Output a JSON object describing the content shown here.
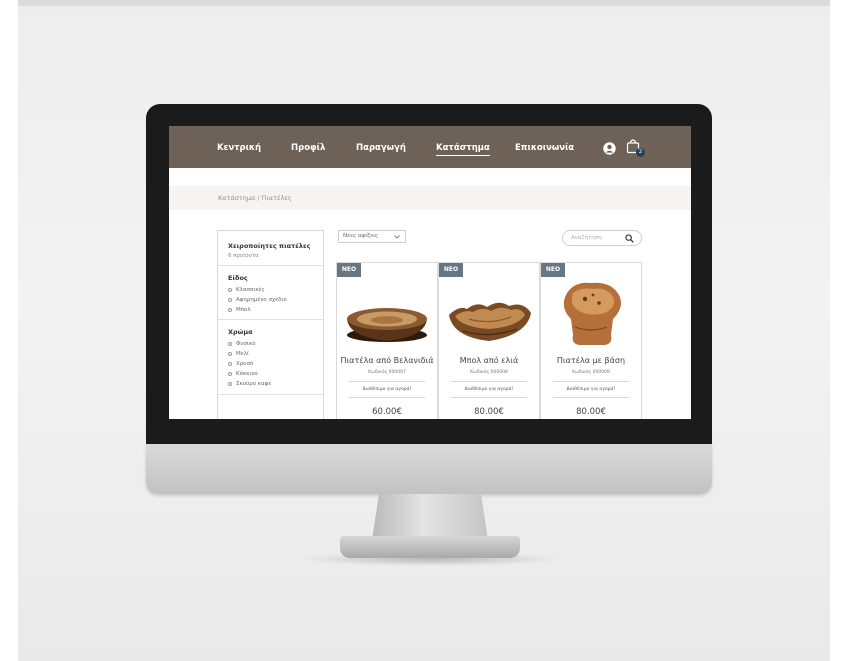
{
  "colors": {
    "nav_background": "#6e6258",
    "badge_background": "#667683",
    "breadcrumb_bar": "#f6f3f0",
    "cart_badge": "#2c3e57"
  },
  "nav": {
    "items": [
      "Κεντρική",
      "Προφίλ",
      "Παραγωγή",
      "Κατάστημα",
      "Επικοινωνία"
    ],
    "active": "Κατάστημα",
    "icons": [
      "user-circle-icon",
      "shopping-bag-icon"
    ],
    "cart_count": "2"
  },
  "breadcrumb": {
    "parent": "Κατάστημα",
    "separator": "/",
    "current": "Πιατέλες"
  },
  "sidebar": {
    "category_title": "Χειροποίητες πιατέλες",
    "category_count": "6 προϊόντα",
    "type_heading": "Είδος",
    "type_options": [
      "Κλασσικές",
      "Αφηρημένο σχέδιο",
      "Μπολ"
    ],
    "color_heading": "Χρώμα",
    "color_options": [
      "Φυσικό",
      "Μελί",
      "Χρυσό",
      "Κόκκινο",
      "Σκούρο καφέ"
    ]
  },
  "toolbar": {
    "sort_selected": "Νέες αφίξεις",
    "search_placeholder": "Αναζήτηση"
  },
  "products": [
    {
      "badge": "ΝΕΟ",
      "name": "Πιατέλα από Βελανιδιά",
      "code": "Κωδικός 000007",
      "availability": "Διαθέσιμο για αγορά!",
      "price": "60.00€",
      "image": "wooden-bowl-image"
    },
    {
      "badge": "ΝΕΟ",
      "name": "Μπολ από ελιά",
      "code": "Κωδικός 000008",
      "availability": "Διαθέσιμο για αγορά!",
      "price": "80.00€",
      "image": "olive-wood-bowl-image"
    },
    {
      "badge": "ΝΕΟ",
      "name": "Πιατέλα με βάση",
      "code": "Κωδικός 000009",
      "availability": "Διαθέσιμο για αγορά!",
      "price": "80.00€",
      "image": "burl-wood-platter-image"
    }
  ]
}
